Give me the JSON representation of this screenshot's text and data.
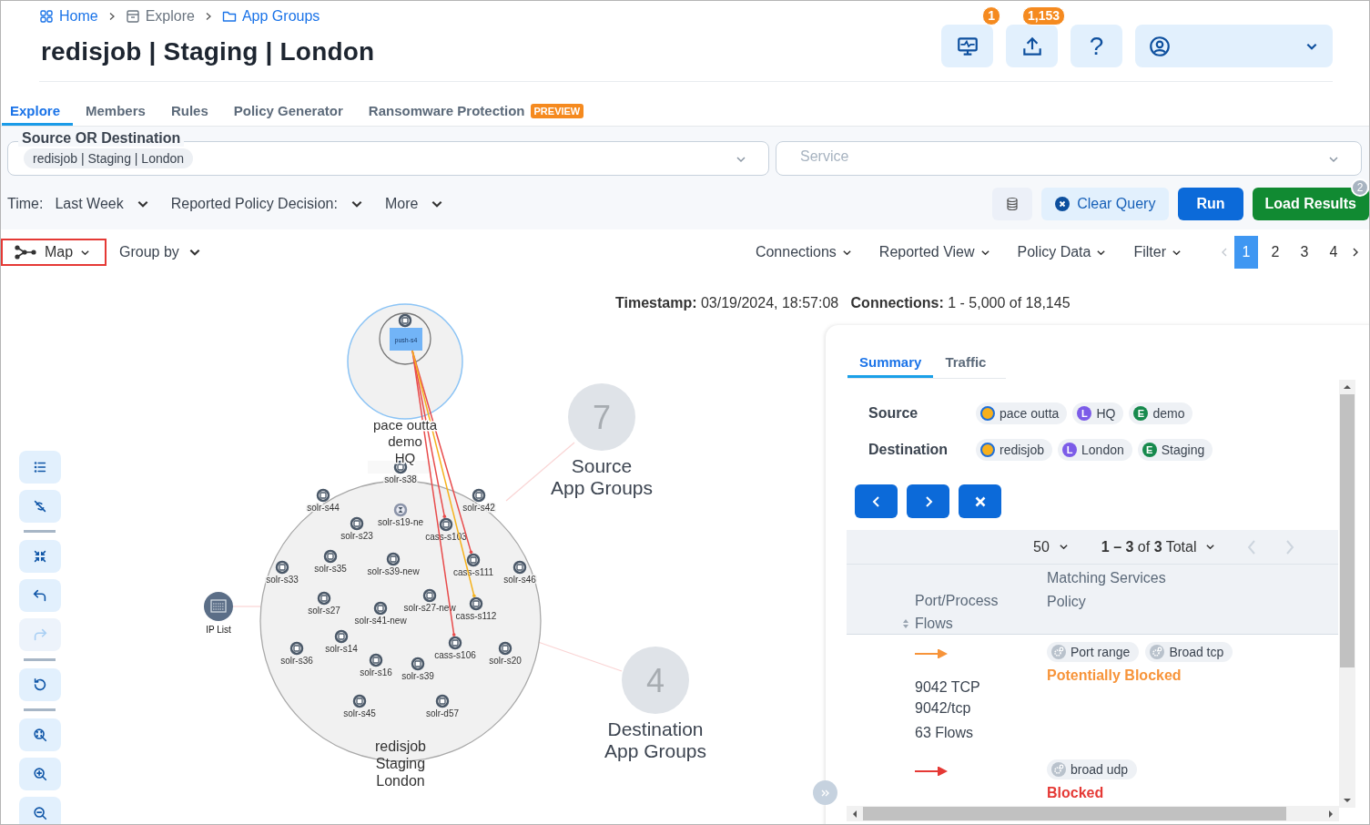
{
  "breadcrumbs": [
    {
      "label": "Home",
      "kind": "home"
    },
    {
      "label": "Explore",
      "kind": "explore"
    },
    {
      "label": "App Groups",
      "kind": "folder"
    }
  ],
  "title": "redisjob | Staging | London",
  "header_actions": [
    {
      "kind": "monitor",
      "badge": "1"
    },
    {
      "kind": "upload",
      "badge": "1,153"
    },
    {
      "kind": "help",
      "label": "?"
    },
    {
      "kind": "user"
    }
  ],
  "tabs": [
    {
      "label": "Explore",
      "selected": true
    },
    {
      "label": "Members",
      "selected": false
    },
    {
      "label": "Rules",
      "selected": false
    },
    {
      "label": "Policy Generator",
      "selected": false
    },
    {
      "label": "Ransomware Protection",
      "selected": false,
      "badge": "PREVIEW"
    }
  ],
  "filters": {
    "source_legend": "Source OR Destination",
    "source_chips": [
      "redisjob | Staging | London"
    ],
    "service_placeholder": "Service",
    "time_label": "Time:",
    "time_value": "Last Week",
    "decision_label": "Reported Policy Decision:",
    "more": "More"
  },
  "query_buttons": {
    "clear": "Clear Query",
    "run": "Run",
    "load": "Load Results",
    "load_badge": "2"
  },
  "view_bar": {
    "view": "Map",
    "group_by": "Group by",
    "menus": [
      "Connections",
      "Reported View",
      "Policy Data",
      "Filter"
    ],
    "pages": [
      {
        "label": "1",
        "selected": true
      },
      {
        "label": "2",
        "selected": false
      },
      {
        "label": "3",
        "selected": false
      },
      {
        "label": "4",
        "selected": false
      }
    ]
  },
  "stats": {
    "timestamp_label": "Timestamp:",
    "timestamp": "03/19/2024, 18:57:08",
    "connections_label": "Connections:",
    "connections": "1 - 5,000 of 18,145"
  },
  "map": {
    "source_group": {
      "lines": [
        "pace outta",
        "demo",
        "HQ"
      ],
      "node": "push-s4"
    },
    "dest_group": {
      "lines": [
        "redisjob",
        "Staging",
        "London"
      ]
    },
    "nodes": [
      {
        "label": "solr-s38",
        "kind": "workload"
      },
      {
        "label": "solr-s44",
        "kind": "workload"
      },
      {
        "label": "solr-s19-ne",
        "kind": "pending"
      },
      {
        "label": "solr-s23",
        "kind": "workload"
      },
      {
        "label": "cass-s103",
        "kind": "workload"
      },
      {
        "label": "solr-s42",
        "kind": "workload"
      },
      {
        "label": "solr-s35",
        "kind": "workload"
      },
      {
        "label": "solr-s39-new",
        "kind": "workload"
      },
      {
        "label": "cass-s111",
        "kind": "workload"
      },
      {
        "label": "solr-s33",
        "kind": "workload"
      },
      {
        "label": "solr-s46",
        "kind": "workload"
      },
      {
        "label": "solr-s27",
        "kind": "workload"
      },
      {
        "label": "solr-s27-new",
        "kind": "workload"
      },
      {
        "label": "cass-s112",
        "kind": "workload"
      },
      {
        "label": "solr-s41-new",
        "kind": "workload"
      },
      {
        "label": "solr-s14",
        "kind": "workload"
      },
      {
        "label": "solr-s36",
        "kind": "workload"
      },
      {
        "label": "cass-s106",
        "kind": "workload"
      },
      {
        "label": "solr-s20",
        "kind": "workload"
      },
      {
        "label": "solr-s16",
        "kind": "workload"
      },
      {
        "label": "solr-s39",
        "kind": "workload"
      },
      {
        "label": "solr-s45",
        "kind": "workload"
      },
      {
        "label": "solr-d57",
        "kind": "workload"
      }
    ],
    "edges": [
      {
        "kind": "blocked"
      },
      {
        "kind": "blocked"
      },
      {
        "kind": "blocked"
      },
      {
        "kind": "potentially_blocked"
      }
    ],
    "ip_list": "IP List",
    "summary_nodes": [
      {
        "count": "7",
        "lines": [
          "Source",
          "App Groups"
        ]
      },
      {
        "count": "4",
        "lines": [
          "Destination",
          "App Groups"
        ]
      }
    ]
  },
  "map_tools": [
    {
      "kind": "list",
      "disabled": false
    },
    {
      "kind": "unlink",
      "disabled": false
    },
    {
      "kind": "divider"
    },
    {
      "kind": "collapse",
      "disabled": false
    },
    {
      "kind": "undo",
      "disabled": false
    },
    {
      "kind": "redo",
      "disabled": true
    },
    {
      "kind": "divider"
    },
    {
      "kind": "reset",
      "disabled": false
    },
    {
      "kind": "divider"
    },
    {
      "kind": "zoom-fit",
      "disabled": false
    },
    {
      "kind": "zoom-in",
      "disabled": false
    },
    {
      "kind": "zoom-out",
      "disabled": false
    }
  ],
  "panel": {
    "tabs": [
      {
        "label": "Summary",
        "selected": true
      },
      {
        "label": "Traffic",
        "selected": false
      }
    ],
    "source_label": "Source",
    "source_chips": [
      {
        "kind": "app",
        "label": "pace outta"
      },
      {
        "kind": "L",
        "label": "HQ"
      },
      {
        "kind": "E",
        "label": "demo"
      }
    ],
    "dest_label": "Destination",
    "dest_chips": [
      {
        "kind": "app",
        "label": "redisjob"
      },
      {
        "kind": "L",
        "label": "London"
      },
      {
        "kind": "E",
        "label": "Staging"
      }
    ],
    "page_size": "50",
    "range": "**1 – 3** of **3** Total",
    "columns": {
      "services": "Matching Services",
      "policy": "Policy",
      "port": "Port/Process",
      "flows": "Flows"
    },
    "rows": [
      {
        "kind": "potentially_blocked",
        "port": "9042 TCP",
        "proto": "9042/tcp",
        "flows": "63 Flows",
        "services": [
          "Port range",
          "Broad tcp"
        ],
        "policy": "Potentially Blocked"
      },
      {
        "kind": "blocked",
        "services": [
          "broad udp"
        ],
        "policy": "Blocked"
      }
    ]
  }
}
